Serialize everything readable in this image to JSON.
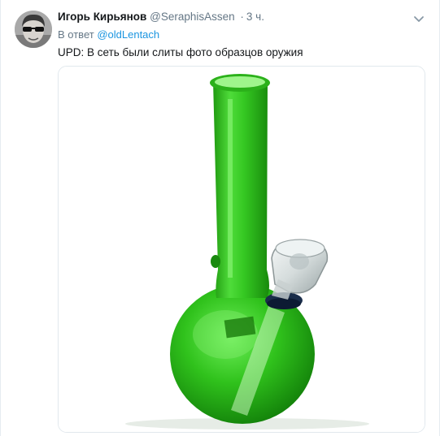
{
  "tweet": {
    "author_name": "Игорь Кирьянов",
    "author_handle": "@SeraphisAssen",
    "separator": "·",
    "time": "3 ч.",
    "reply_prefix": "В ответ",
    "reply_handle": "@oldLentach",
    "text": "UPD: В сеть были слиты фото образцов оружия",
    "media_icon": "bong-photo"
  },
  "colors": {
    "link": "#1b95e0",
    "secondary_text": "#657786",
    "primary_text": "#14171a",
    "border": "#e1e8ed",
    "glass_green": "#2fc21a"
  }
}
